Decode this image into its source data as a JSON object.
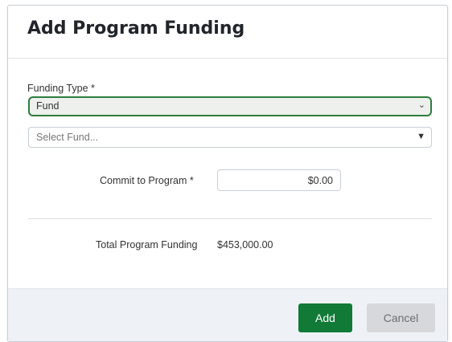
{
  "dialog": {
    "title": "Add Program Funding"
  },
  "form": {
    "funding_type": {
      "label": "Funding Type *",
      "selected": "Fund",
      "chevron_icon": "chevron-down-icon"
    },
    "fund_select": {
      "placeholder": "Select Fund...",
      "caret_icon": "caret-down-icon"
    },
    "commit": {
      "label": "Commit to Program *",
      "value": "$0.00"
    },
    "total": {
      "label": "Total Program Funding",
      "value": "$453,000.00"
    }
  },
  "footer": {
    "add_label": "Add",
    "cancel_label": "Cancel"
  },
  "colors": {
    "primary": "#117a37",
    "focus_border": "#2e7d3c",
    "footer_bg": "#eef2f7",
    "cancel_bg": "#d6d8db"
  }
}
